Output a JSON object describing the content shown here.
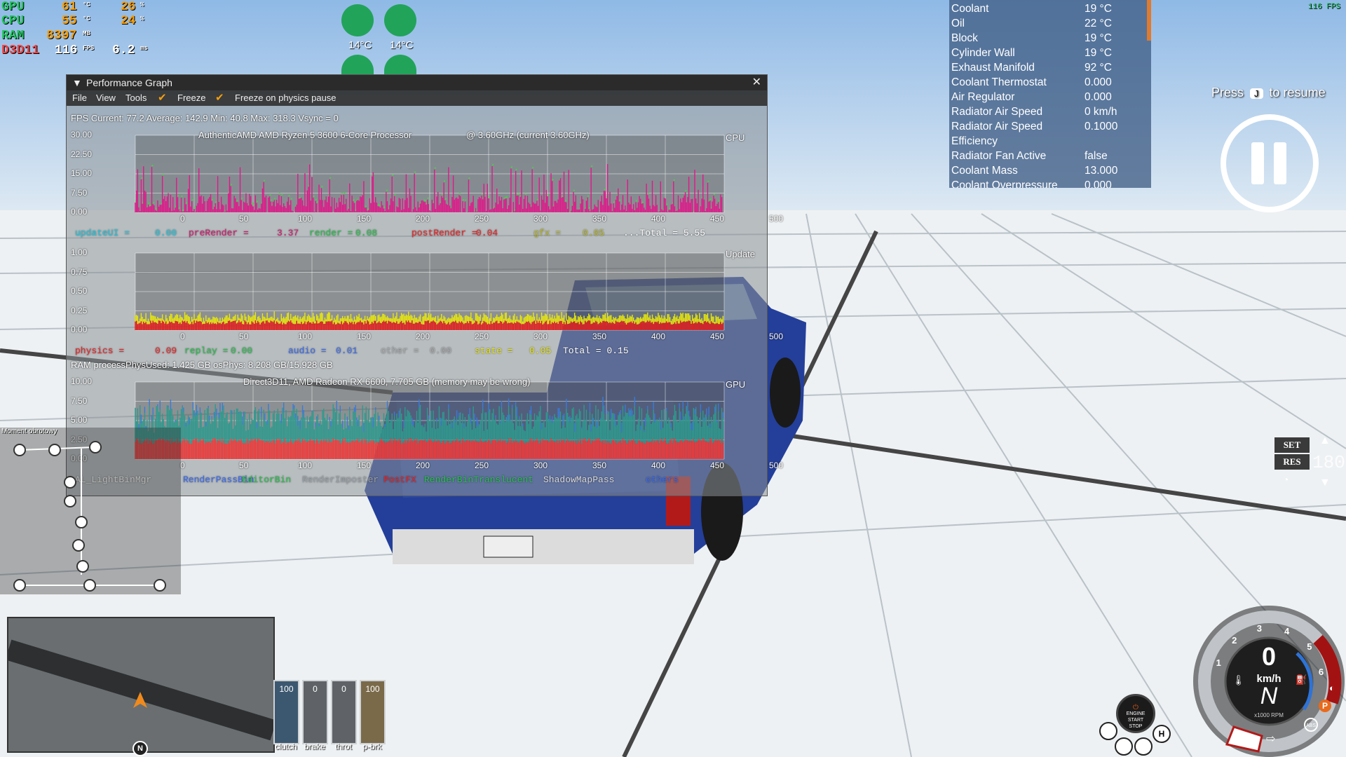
{
  "osd": {
    "gpu_label": "GPU",
    "gpu_temp": "61",
    "gpu_temp_unit": "°C",
    "gpu_load": "26",
    "gpu_load_unit": "%",
    "cpu_label": "CPU",
    "cpu_temp": "55",
    "cpu_temp_unit": "°C",
    "cpu_load": "24",
    "cpu_load_unit": "%",
    "ram_label": "RAM",
    "ram_val": "8397",
    "ram_unit": "MB",
    "api_label": "D3D11",
    "fps": "116",
    "fps_unit": "FPS",
    "frametime": "6.2",
    "frametime_unit": "ms"
  },
  "top_right_fps": "116 FPS",
  "brakes": {
    "left_temp": "14°C",
    "right_temp": "14°C"
  },
  "perf": {
    "title": "Performance Graph",
    "menu": {
      "file": "File",
      "view": "View",
      "tools": "Tools",
      "freeze": "Freeze",
      "freeze_physics": "Freeze on physics pause"
    },
    "fps_line": "FPS  Current: 77.2  Average: 142.9  Min: 40.8  Max: 318.3 Vsync = 0",
    "cpu_label": "CPU",
    "cpu_name": "AuthenticAMD AMD Ryzen 5 3600 6-Core Processor",
    "cpu_clock": "@ 3.60GHz (current 3.60GHz)",
    "cpu_yticks": [
      "30.00",
      "22.50",
      "15.00",
      "7.50",
      "0.00"
    ],
    "xticks": [
      "0",
      "50",
      "100",
      "150",
      "200",
      "250",
      "300",
      "350",
      "400",
      "450",
      "500"
    ],
    "cpu_legend": [
      {
        "text": "updateUI =",
        "color": "#1ec8e0"
      },
      {
        "text": "0.00",
        "color": "#1ec8e0"
      },
      {
        "text": "preRender =",
        "color": "#d6186e"
      },
      {
        "text": "3.37",
        "color": "#d6186e"
      },
      {
        "text": "render =",
        "color": "#26c24a"
      },
      {
        "text": "0.08",
        "color": "#26c24a"
      },
      {
        "text": "postRender =",
        "color": "#ee2222"
      },
      {
        "text": "0.04",
        "color": "#ee2222"
      },
      {
        "text": "gfx =",
        "color": "#b9b92a"
      },
      {
        "text": "0.05",
        "color": "#b9b92a"
      },
      {
        "text": "...Total = 5.55",
        "color": "#ffffff"
      }
    ],
    "update_label": "Update",
    "update_yticks": [
      "1.00",
      "0.75",
      "0.50",
      "0.25",
      "0.00"
    ],
    "update_legend": [
      {
        "text": "physics =",
        "color": "#ee2222"
      },
      {
        "text": "0.09",
        "color": "#ee2222"
      },
      {
        "text": "replay =",
        "color": "#26c24a"
      },
      {
        "text": "0.00",
        "color": "#26c24a"
      },
      {
        "text": "audio =",
        "color": "#3b6cf0"
      },
      {
        "text": "0.01",
        "color": "#3b6cf0"
      },
      {
        "text": "other =",
        "color": "#a8a8a8"
      },
      {
        "text": "0.00",
        "color": "#a8a8a8"
      },
      {
        "text": "state =",
        "color": "#e8e80a"
      },
      {
        "text": "0.05",
        "color": "#e8e80a"
      },
      {
        "text": "Total = 0.15",
        "color": "#ffffff"
      }
    ],
    "ram_line": "RAM  processPhysUsed: 1.425 GB  osPhys: 8.208 GB/15.928 GB",
    "gpu_label": "GPU",
    "gpu_name": "Direct3D11, AMD Radeon RX 6600, 7.705 GB (memory may be wrong)",
    "gpu_yticks": [
      "10.00",
      "7.50",
      "5.00",
      "2.50",
      "0.00"
    ],
    "gpu_legend": [
      {
        "text": "AL_LightBinMgr",
        "color": "#ffffff"
      },
      {
        "text": "RenderPassBin",
        "color": "#3b6cf0"
      },
      {
        "text": "EditorBin",
        "color": "#26c24a"
      },
      {
        "text": "RenderImposter",
        "color": "#9aa0a6"
      },
      {
        "text": "PostFX",
        "color": "#ee2222"
      },
      {
        "text": "RenderBinTranslucent",
        "color": "#26c24a"
      },
      {
        "text": "ShadowMapPass",
        "color": "#d8d8d8"
      },
      {
        "text": "others",
        "color": "#3b6cf0"
      }
    ]
  },
  "temps": {
    "rows": [
      {
        "label": "Coolant",
        "value": "19 °C"
      },
      {
        "label": "Oil",
        "value": "22 °C"
      },
      {
        "label": "Block",
        "value": "19 °C"
      },
      {
        "label": "Cylinder Wall",
        "value": "19 °C"
      },
      {
        "label": "Exhaust Manifold",
        "value": "92 °C"
      },
      {
        "label": "Coolant Thermostat",
        "value": "0.000"
      },
      {
        "label": "Air Regulator",
        "value": "0.000"
      },
      {
        "label": "Radiator Air Speed",
        "value": "0 km/h"
      },
      {
        "label": "Radiator Air Speed",
        "value": "0.1000"
      },
      {
        "label": "Efficiency",
        "value": ""
      },
      {
        "label": "Radiator Fan Active",
        "value": "false"
      },
      {
        "label": "Coolant Mass",
        "value": "13.000"
      },
      {
        "label": "Coolant Overpressure",
        "value": "0.000"
      }
    ]
  },
  "resume": {
    "press": "Press",
    "key": "J",
    "to_resume": "to resume"
  },
  "torque_title": "Moment obrotowy",
  "pedals": [
    {
      "label": "clutch",
      "value": "100",
      "level": 1.0,
      "color": "#3c5870"
    },
    {
      "label": "brake",
      "value": "0",
      "level": 0.0,
      "color": "#8a8a8a"
    },
    {
      "label": "throt",
      "value": "0",
      "level": 0.0,
      "color": "#8a8a8a"
    },
    {
      "label": "p-brk",
      "value": "100",
      "level": 1.0,
      "color": "#7a6a4a"
    }
  ],
  "cruise": {
    "set": "SET",
    "res": "RES",
    "speed": "180"
  },
  "engine_button": {
    "line1": "ENGINE",
    "line2": "START",
    "line3": "STOP"
  },
  "dash": {
    "speed": "0",
    "unit": "km/h",
    "gear": "N",
    "rpm_label": "x1000 RPM",
    "rpm_ticks": [
      "1",
      "2",
      "3",
      "4",
      "5",
      "6"
    ],
    "p": "P",
    "abs": "ABS"
  },
  "minimap": {
    "north": "N"
  }
}
